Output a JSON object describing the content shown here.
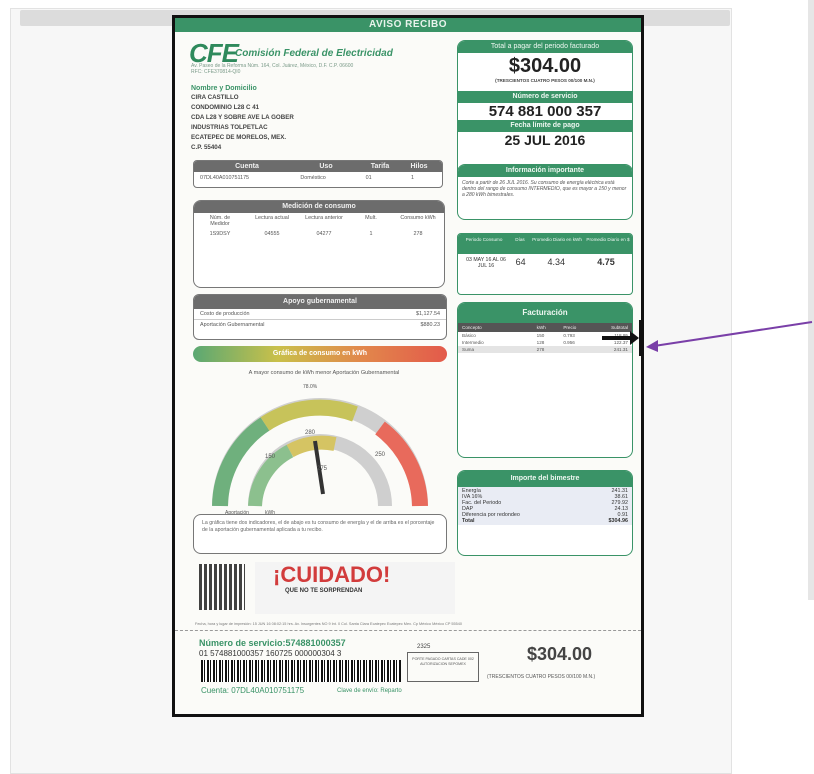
{
  "header": {
    "title": "AVISO RECIBO"
  },
  "company": {
    "logo": "CFE",
    "name": "Comisión Federal de Electricidad",
    "address": "Av. Paseo de la Reforma Núm. 164, Col. Juárez, México, D.F. C.P. 06600",
    "rfc": "RFC: CFE370814-QI0"
  },
  "customer": {
    "label": "Nombre y Domicilio",
    "lines": [
      "CIRA CASTILLO",
      "CONDOMINIO L28 C 41",
      "CDA L28 Y SOBRE AVE LA GOBER",
      "INDUSTRIAS TOLPETLAC",
      "ECATEPEC DE MORELOS, MEX.",
      "C.P. 55404"
    ]
  },
  "account": {
    "headers": [
      "Cuenta",
      "Uso",
      "Tarifa",
      "Hilos"
    ],
    "values": [
      "07DL40A010751175",
      "Doméstico",
      "01",
      "1"
    ]
  },
  "medicion": {
    "title": "Medición de consumo",
    "headers": [
      "Núm. de Medidor",
      "Lectura actual",
      "Lectura anterior",
      "Mult.",
      "Consumo kWh"
    ],
    "values": [
      "1S9DSY",
      "04555",
      "04277",
      "1",
      "278"
    ]
  },
  "apoyo": {
    "title": "Apoyo gubernamental",
    "rows": [
      [
        "Costo de producción",
        "$1,127.54"
      ],
      [
        "Aportación Gubernamental",
        "$880.23"
      ]
    ]
  },
  "grafica": {
    "title": "Gráfica de consumo en kWh",
    "subtitle": "A mayor consumo de kWh menor Aportación Gubernamental",
    "pct": "78.0%",
    "marks": [
      "150",
      "280",
      "250",
      "275"
    ],
    "labels": [
      "Aportación",
      "kWh"
    ],
    "note": "La gráfica tiene dos indicadores, el de abajo es tu consumo de energía y el de arriba es el porcentaje de la aportación gubernamental aplicada a tu recibo."
  },
  "cuidado": {
    "title": "¡CUIDADO!",
    "sub": "QUE NO TE SORPRENDAN"
  },
  "total": {
    "label": "Total a pagar del periodo facturado",
    "amount": "$304.00",
    "words": "(TRESCIENTOS CUATRO PESOS 00/100 M.N.)"
  },
  "servicio": {
    "label": "Número de servicio",
    "number": "574 881 000 357"
  },
  "limite": {
    "label": "Fecha límite de pago",
    "date": "25 JUL 2016"
  },
  "info": {
    "title": "Información importante",
    "text": "Corte a partir de 26 JUL 2016. Su consumo de energía eléctrica está dentro del rango de consumo INTERMEDIO, que es mayor a 150 y menor a 280 kWh bimestrales."
  },
  "periodo": {
    "headers": [
      "Periodo Consumo",
      "Días",
      "Promedio Diario en kWh",
      "Promedio Diario en $"
    ],
    "values": [
      "03 MAY 16 AL 06 JUL 16",
      "64",
      "4.34",
      "4.75"
    ]
  },
  "facturacion": {
    "title": "Facturación",
    "headers": [
      "Concepto",
      "kWh",
      "Precio",
      "Subtotal"
    ],
    "rows": [
      [
        "Básico",
        "150",
        "0.793",
        "118.95"
      ],
      [
        "Intermedio",
        "128",
        "0.956",
        "122.37"
      ],
      [
        "Suma",
        "278",
        "",
        "241.31"
      ]
    ]
  },
  "importe": {
    "title": "Importe del bimestre",
    "rows": [
      [
        "Energía",
        "241.31"
      ],
      [
        "IVA 16%",
        "38.61"
      ],
      [
        "Fac. del Periodo",
        "279.92"
      ],
      [
        "DAP",
        "24.13"
      ],
      [
        "Diferencia por redondeo",
        "0.91"
      ],
      [
        "Total",
        "$304.96"
      ]
    ]
  },
  "footer": {
    "printline": "Fecha, hora y lugar de impresión: 15 JUN 16 08:02:15 hrs. Av. Insurgentes NO 9 Int. 0 Col. Santa Clara Ecatepec Ecatepec Mex. Cp México México CP 55540",
    "servicio": "Número de servicio:574881000357",
    "line2": "01 574881000357 160725 000000304 3",
    "code": "2325",
    "stamp": "PORTE PAGADO CARTAS CADE 002 AUTORIZACION SEPOMEX",
    "amount": "$304.00",
    "words": "(TRESCIENTOS CUATRO PESOS 00/100 M.N.)",
    "cuenta": "Cuenta: 07DL40A010751175",
    "clave": "Clave de envío: Reparto"
  },
  "colors": {
    "green": "#3a9367",
    "gray": "#6c6c6c",
    "pointer": "#7a3fa8"
  }
}
